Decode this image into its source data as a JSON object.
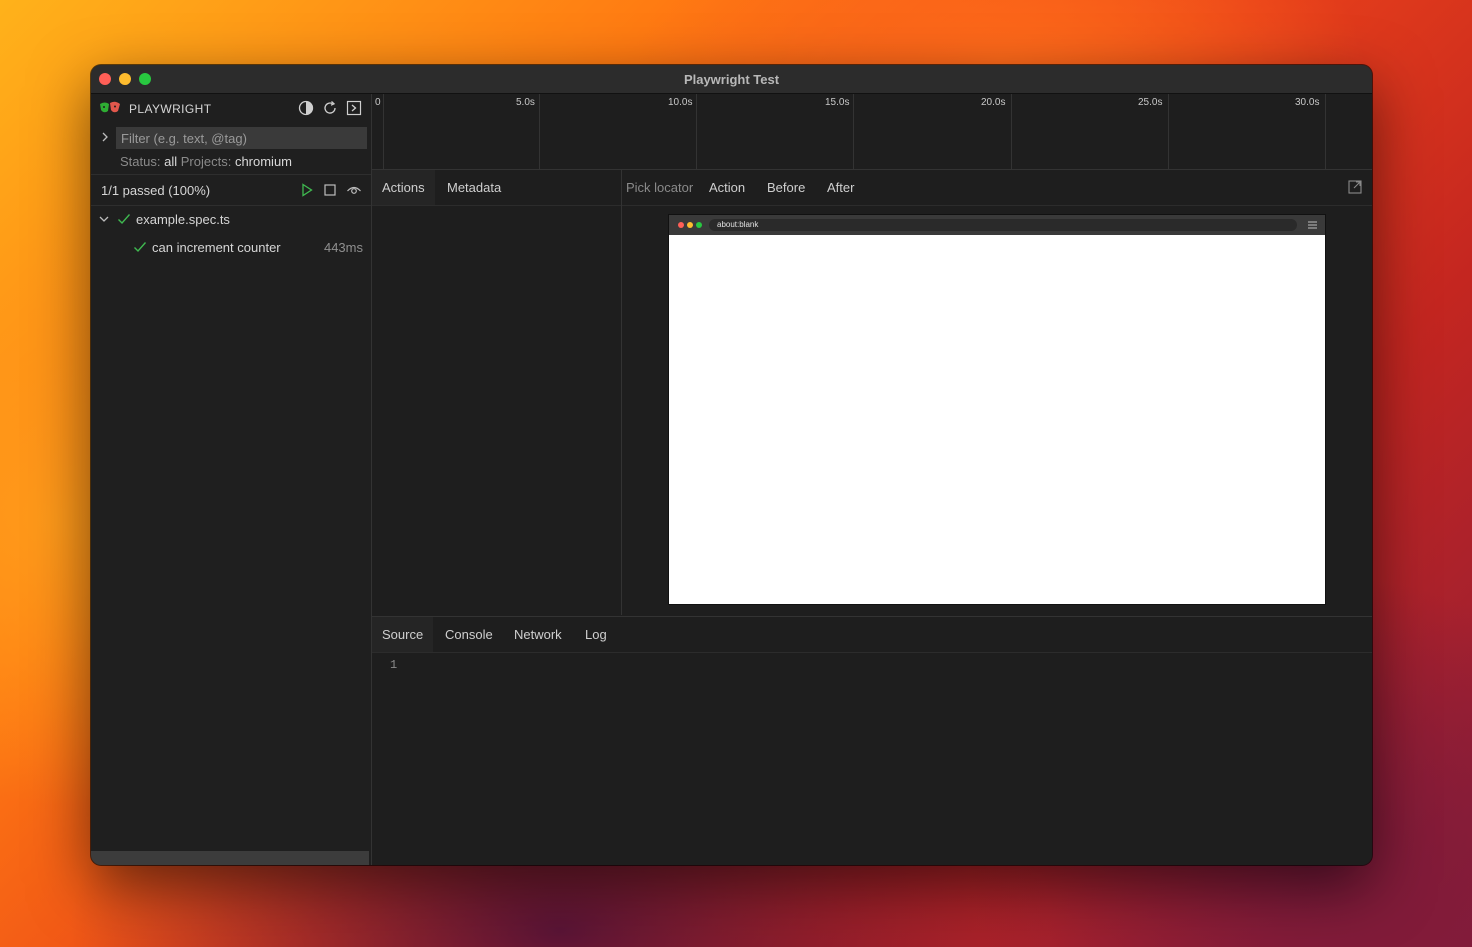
{
  "window": {
    "title": "Playwright Test"
  },
  "sidebar": {
    "brand": "PLAYWRIGHT",
    "filter": {
      "placeholder": "Filter (e.g. text, @tag)",
      "value": ""
    },
    "status": {
      "status_label": "Status:",
      "status_value": "all",
      "projects_label": "Projects:",
      "projects_value": "chromium"
    },
    "summary": "1/1 passed (100%)",
    "tree": [
      {
        "label": "example.spec.ts",
        "expanded": true,
        "state": "passed"
      },
      {
        "label": "can increment counter",
        "time": "443ms",
        "state": "passed"
      }
    ]
  },
  "timeline": {
    "ticks": [
      "0",
      "5.0s",
      "10.0s",
      "15.0s",
      "20.0s",
      "25.0s",
      "30.0s"
    ]
  },
  "actions_tabs": [
    "Actions",
    "Metadata"
  ],
  "snapshot_tabs": [
    "Pick locator",
    "Action",
    "Before",
    "After"
  ],
  "snapshot": {
    "url": "about:blank"
  },
  "bottom_tabs": [
    "Source",
    "Console",
    "Network",
    "Log"
  ],
  "source": {
    "line_numbers": [
      "1"
    ]
  },
  "colors": {
    "accent_green": "#28c840",
    "pass_green": "#3fb950",
    "close": "#ff5f57",
    "minimize": "#febc2e",
    "maximize": "#28c840"
  },
  "icons": [
    "playwright-logo-icon",
    "theme-toggle-icon",
    "reload-icon",
    "terminal-icon",
    "chevron-right-icon",
    "run-icon",
    "stop-icon",
    "watch-icon",
    "chevron-down-icon",
    "check-icon",
    "popout-icon",
    "hamburger-menu-icon"
  ]
}
